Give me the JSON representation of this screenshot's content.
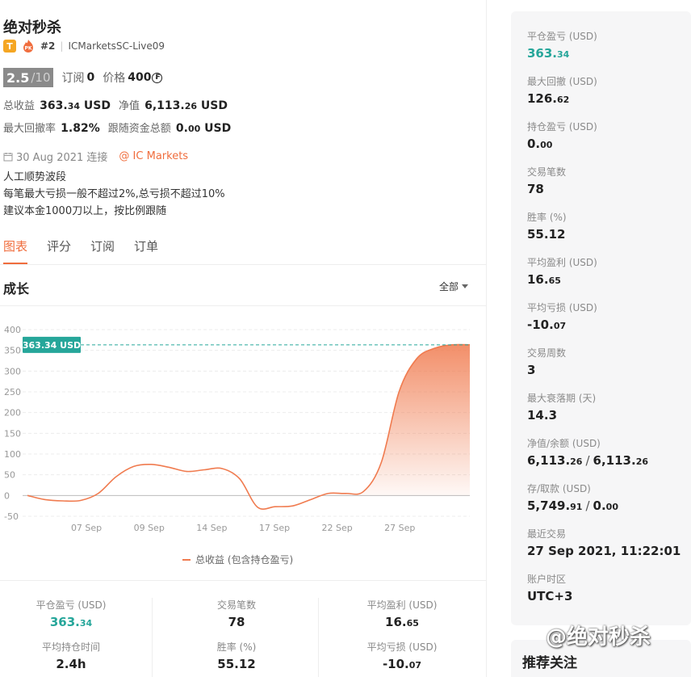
{
  "strategy": {
    "name": "绝对秒杀",
    "badge_t": "T",
    "badge_pk": "PK",
    "rank_prefix": "#2",
    "account": "ICMarketsSC-Live09",
    "score": "2.5",
    "score_max": "/10",
    "subscribe_label": "订阅",
    "subscribe_value": "0",
    "price_label": "价格",
    "price_value": "400",
    "coin_symbol": "₣",
    "total_profit_label": "总收益",
    "total_profit_int": "363.",
    "total_profit_dec": "34",
    "total_profit_unit": " USD",
    "equity_label": "净值",
    "equity_int": "6,113.",
    "equity_dec": "26",
    "equity_unit": " USD",
    "max_dd_label": "最大回撤率",
    "max_dd_value": "1.82%",
    "follow_label": "跟随资金总额",
    "follow_int": "0.",
    "follow_dec": "00",
    "follow_unit": " USD",
    "connect_date": "30 Aug 2021 连接",
    "broker": "@ IC Markets",
    "desc_lines": [
      "人工顺势波段",
      "每笔最大亏损一般不超过2%,总亏损不超过10%",
      "建议本金1000刀以上，按比例跟随"
    ]
  },
  "tabs": [
    "图表",
    "评分",
    "订阅",
    "订单"
  ],
  "chart_section": {
    "title": "成长",
    "range": "全部"
  },
  "colors": {
    "accent": "#f06d3d",
    "green": "#26a69a",
    "line": "#f07b4f"
  },
  "chart_data": {
    "type": "area",
    "title": "",
    "xlabel": "",
    "ylabel": "",
    "ylim": [
      -50,
      400
    ],
    "yticks": [
      400,
      350,
      300,
      250,
      200,
      150,
      100,
      50,
      0,
      -50
    ],
    "xticks": [
      "07 Sep",
      "09 Sep",
      "14 Sep",
      "17 Sep",
      "22 Sep",
      "27 Sep"
    ],
    "current_label": "363.34 USD",
    "current_value": 363.34,
    "series": [
      {
        "name": "总收益 (包含持仓盈亏)",
        "points": [
          [
            0,
            0
          ],
          [
            1,
            -10
          ],
          [
            2,
            -13
          ],
          [
            3,
            -12
          ],
          [
            4,
            5
          ],
          [
            5,
            45
          ],
          [
            6,
            70
          ],
          [
            7,
            75
          ],
          [
            8,
            68
          ],
          [
            9,
            58
          ],
          [
            10,
            62
          ],
          [
            11,
            65
          ],
          [
            12,
            40
          ],
          [
            13,
            -28
          ],
          [
            14,
            -27
          ],
          [
            15,
            -25
          ],
          [
            16,
            -10
          ],
          [
            17,
            5
          ],
          [
            18,
            5
          ],
          [
            19,
            10
          ],
          [
            20,
            80
          ],
          [
            21,
            250
          ],
          [
            22,
            330
          ],
          [
            23,
            355
          ],
          [
            24,
            363.34
          ],
          [
            25,
            363.34
          ]
        ]
      }
    ]
  },
  "legend": "总收益 (包含持仓盈亏)",
  "bottom_stats": [
    {
      "label": "平仓盈亏 (USD)",
      "int": "363.",
      "dec": "34",
      "green": true
    },
    {
      "label": "交易笔数",
      "int": "78",
      "dec": ""
    },
    {
      "label": "平均盈利 (USD)",
      "int": "16.",
      "dec": "65"
    },
    {
      "label": "平均持仓时间",
      "int": "2.4h",
      "dec": ""
    },
    {
      "label": "胜率 (%)",
      "int": "55.12",
      "dec": ""
    },
    {
      "label": "平均亏损 (USD)",
      "int": "-10.",
      "dec": "07"
    }
  ],
  "side_stats": [
    {
      "label": "平仓盈亏 (USD)",
      "int": "363.",
      "dec": "34",
      "green": true
    },
    {
      "label": "最大回撤 (USD)",
      "int": "126.",
      "dec": "62"
    },
    {
      "label": "持仓盈亏 (USD)",
      "int": "0.",
      "dec": "00"
    },
    {
      "label": "交易笔数",
      "int": "78",
      "dec": ""
    },
    {
      "label": "胜率 (%)",
      "int": "55.12",
      "dec": ""
    },
    {
      "label": "平均盈利 (USD)",
      "int": "16.",
      "dec": "65"
    },
    {
      "label": "平均亏损 (USD)",
      "int": "-10.",
      "dec": "07"
    },
    {
      "label": "交易周数",
      "int": "3",
      "dec": ""
    },
    {
      "label": "最大衰落期 (天)",
      "int": "14.3",
      "dec": ""
    },
    {
      "label": "净值/余额 (USD)",
      "int": "6,113.",
      "dec": "26",
      "int2": "6,113.",
      "dec2": "26"
    },
    {
      "label": "存/取款 (USD)",
      "int": "5,749.",
      "dec": "91",
      "int2": "0.",
      "dec2": "00"
    },
    {
      "label": "最近交易",
      "int": "27 Sep 2021, 11:22:01",
      "dec": ""
    },
    {
      "label": "账户时区",
      "int": "UTC+3",
      "dec": ""
    }
  ],
  "recommend_title": "推荐关注",
  "watermark": "@绝对秒杀"
}
